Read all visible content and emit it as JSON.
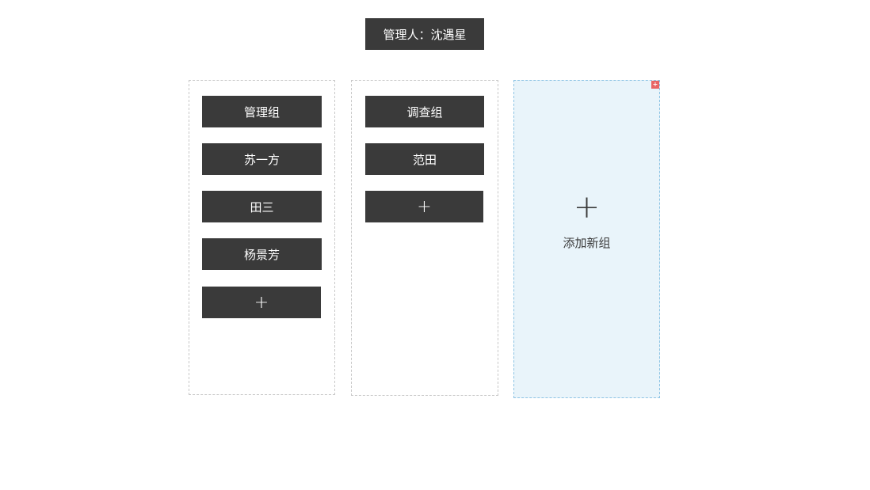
{
  "header": {
    "manager_label": "管理人：沈遇星"
  },
  "groups": [
    {
      "name": "管理组",
      "members": [
        "苏一方",
        "田三",
        "杨景芳"
      ],
      "add_label": "+"
    },
    {
      "name": "调查组",
      "members": [
        "范田"
      ],
      "add_label": "+"
    }
  ],
  "add_group": {
    "plus": "+",
    "label": "添加新组",
    "badge": "+"
  }
}
